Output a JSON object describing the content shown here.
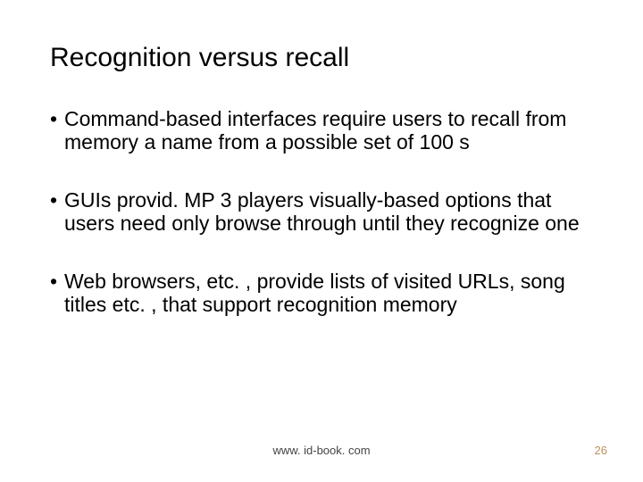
{
  "title": "Recognition versus recall",
  "bullets": [
    "Command-based interfaces require users to recall from memory a name from a possible set of 100 s",
    "GUIs provid. MP 3 players visually-based options that users need only browse through until they recognize one",
    "Web browsers, etc. , provide lists of visited URLs, song titles etc. , that support recognition memory"
  ],
  "footer": {
    "url": "www. id-book. com",
    "page": "26"
  }
}
